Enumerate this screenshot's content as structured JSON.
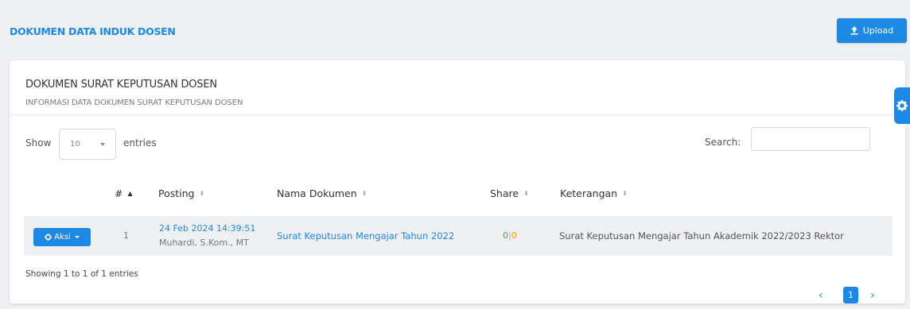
{
  "header": {
    "title": "DOKUMEN DATA INDUK DOSEN",
    "upload_label": "Upload"
  },
  "card": {
    "title": "DOKUMEN SURAT KEPUTUSAN DOSEN",
    "subtitle": "INFORMASI DATA DOKUMEN SURAT KEPUTUSAN DOSEN"
  },
  "controls": {
    "show_label": "Show",
    "length_value": "10",
    "entries_label": "entries",
    "search_label": "Search:",
    "search_value": ""
  },
  "table": {
    "columns": [
      "#",
      "Posting",
      "Nama Dokumen",
      "Share",
      "Keterangan"
    ],
    "rows": [
      {
        "action_label": "Aksi",
        "num": "1",
        "posting_date": "24 Feb 2024 14:39:51",
        "posting_user": "Muhardi, S.Kom., MT",
        "doc_name": "Surat Keputusan Mengajar Tahun 2022",
        "share_a": "0",
        "share_sep": "|",
        "share_b": "0",
        "keterangan": "Surat Keputusan Mengajar Tahun Akademik 2022/2023 Rektor"
      }
    ]
  },
  "footer": {
    "info": "Showing 1 to 1 of 1 entries",
    "current_page": "1"
  },
  "icons": {
    "upload": "upload-icon",
    "gear": "gear-icon",
    "prev": "chevron-left-icon",
    "next": "chevron-right-icon"
  },
  "colors": {
    "accent": "#1e88e5",
    "share_green": "#4caf50",
    "share_orange": "#ff9800"
  }
}
